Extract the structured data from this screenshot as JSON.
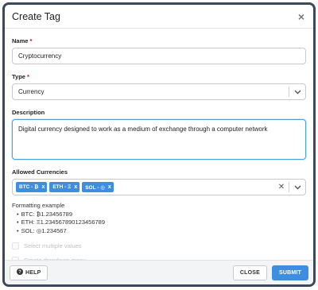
{
  "modal": {
    "title": "Create Tag",
    "close_glyph": "×"
  },
  "form": {
    "name": {
      "label": "Name",
      "required_mark": "*",
      "value": "Cryptocurrency"
    },
    "type": {
      "label": "Type",
      "required_mark": "*",
      "value": "Currency"
    },
    "description": {
      "label": "Description",
      "value": "Digital currency designed to work as a medium of exchange through a computer network"
    },
    "allowed_currencies": {
      "label": "Allowed Currencies",
      "chips": [
        {
          "label": "BTC - ₿"
        },
        {
          "label": "ETH - Ξ"
        },
        {
          "label": "SOL - ◎"
        }
      ],
      "chip_remove_glyph": "x",
      "clear_glyph": "✕"
    },
    "formatting": {
      "heading": "Formatting example",
      "examples": [
        "BTC: ₿1.23456789",
        "ETH: Ξ1.234567890123456789",
        "SOL: ◎1.234567"
      ]
    },
    "options": [
      {
        "label": "Select multiple values",
        "checked": false,
        "disabled": true
      },
      {
        "label": "Create dropdown menu",
        "checked": false,
        "disabled": true
      }
    ]
  },
  "footer": {
    "help_label": "HELP",
    "close_label": "CLOSE",
    "submit_label": "SUBMIT"
  },
  "colors": {
    "accent": "#3d8ee0",
    "required": "#d0021b",
    "focus_border": "#4aa3df",
    "modal_border": "#3a4a5c"
  }
}
